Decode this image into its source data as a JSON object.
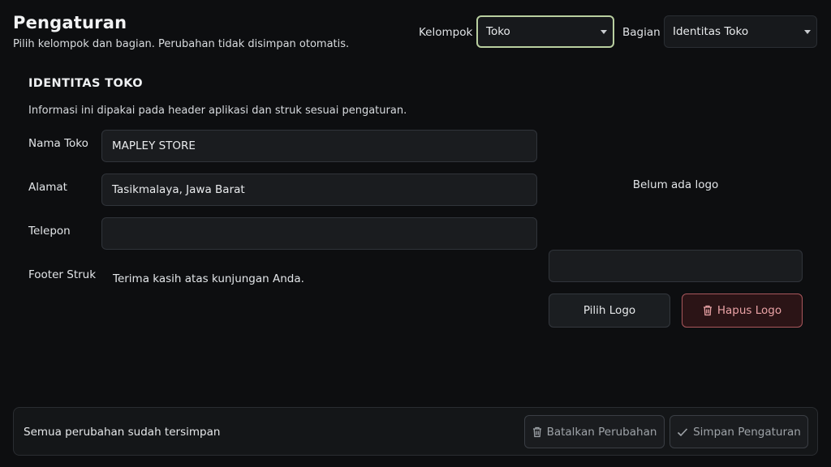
{
  "header": {
    "title": "Pengaturan",
    "subtitle": "Pilih kelompok dan bagian. Perubahan tidak disimpan otomatis."
  },
  "filters": {
    "group_label": "Kelompok",
    "group_value": "Toko",
    "section_label": "Bagian",
    "section_value": "Identitas Toko"
  },
  "section": {
    "title": "IDENTITAS TOKO",
    "description": "Informasi ini dipakai pada header aplikasi dan struk sesuai pengaturan."
  },
  "form": {
    "name_label": "Nama Toko",
    "name_value": "MAPLEY STORE",
    "address_label": "Alamat",
    "address_value": "Tasikmalaya, Jawa Barat",
    "phone_label": "Telepon",
    "phone_value": "",
    "footer_label": "Footer Struk",
    "footer_value": "Terima kasih atas kunjungan Anda."
  },
  "logo": {
    "empty_text": "Belum ada logo",
    "path_value": "",
    "pick_label": "Pilih Logo",
    "delete_label": "Hapus Logo"
  },
  "bottom_bar": {
    "status": "Semua perubahan sudah tersimpan",
    "cancel_label": "Batalkan Perubahan",
    "save_label": "Simpan Pengaturan"
  },
  "icons": {
    "trash": "trash-icon",
    "check": "check-icon",
    "caret": "caret-down-icon"
  },
  "colors": {
    "background": "#0d0e10",
    "focus_border": "#b9cfa0",
    "danger_border": "#a9575c",
    "danger_text": "#eaa3a6",
    "disabled_text": "#9ea3a8"
  }
}
